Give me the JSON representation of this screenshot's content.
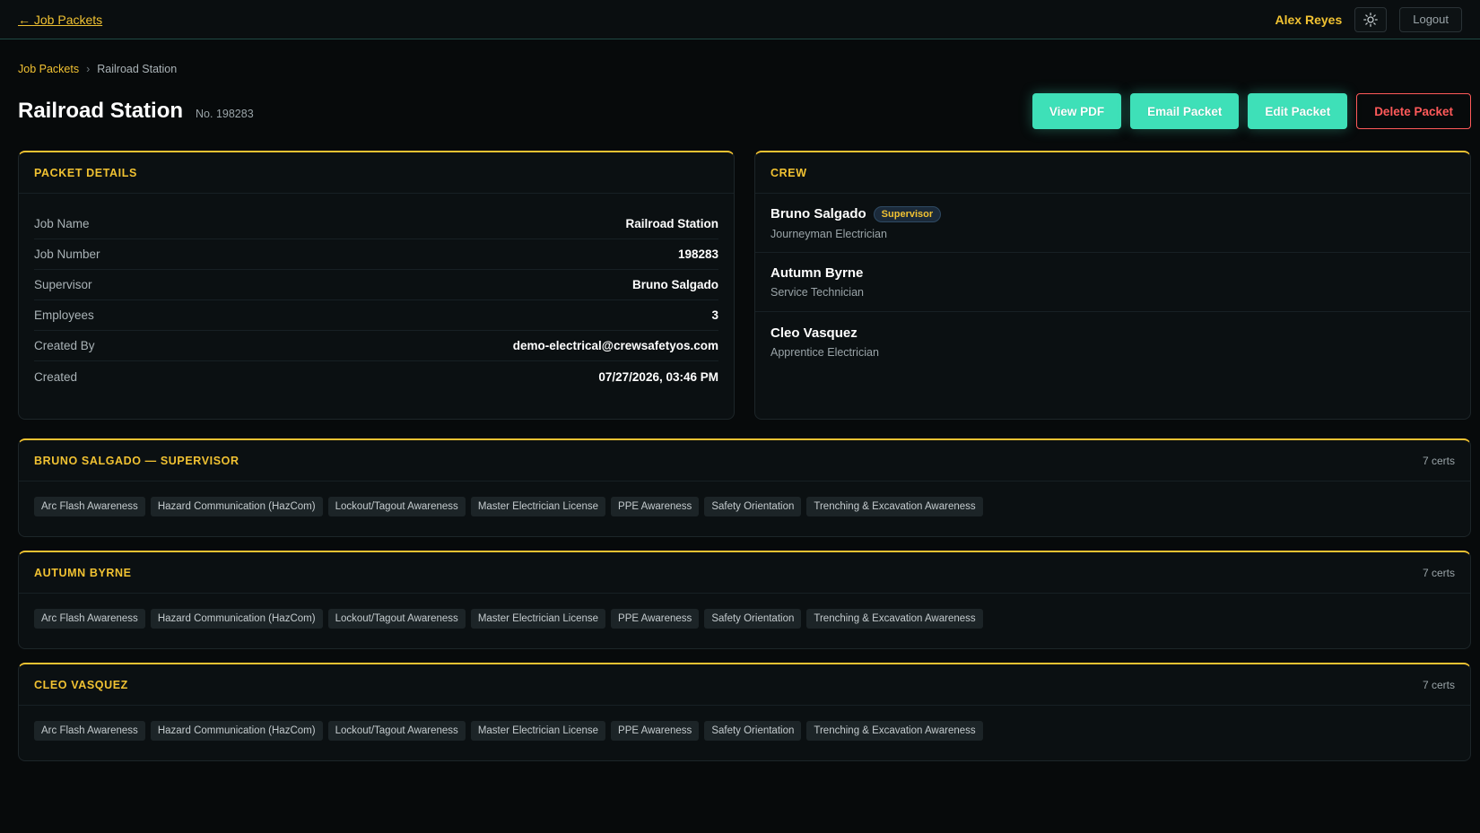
{
  "topbar": {
    "back_label": "← Job Packets",
    "user_name": "Alex Reyes",
    "logout_label": "Logout"
  },
  "breadcrumb": {
    "parent": "Job Packets",
    "separator": "›",
    "current": "Railroad Station"
  },
  "header": {
    "title": "Railroad Station",
    "job_no": "No. 198283",
    "actions": {
      "view_pdf": "View PDF",
      "email_packet": "Email Packet",
      "edit_packet": "Edit Packet",
      "delete_packet": "Delete Packet"
    }
  },
  "packet_details": {
    "title": "PACKET DETAILS",
    "rows": [
      {
        "label": "Job Name",
        "value": "Railroad Station"
      },
      {
        "label": "Job Number",
        "value": "198283"
      },
      {
        "label": "Supervisor",
        "value": "Bruno Salgado"
      },
      {
        "label": "Employees",
        "value": "3"
      },
      {
        "label": "Created By",
        "value": "demo-electrical@crewsafetyos.com"
      },
      {
        "label": "Created",
        "value": "07/27/2026, 03:46 PM"
      }
    ]
  },
  "crew": {
    "title": "CREW",
    "members": [
      {
        "name": "Bruno Salgado",
        "badge": "Supervisor",
        "role": "Journeyman Electrician"
      },
      {
        "name": "Autumn Byrne",
        "badge": "",
        "role": "Service Technician"
      },
      {
        "name": "Cleo Vasquez",
        "badge": "",
        "role": "Apprentice Electrician"
      }
    ]
  },
  "cert_sections": [
    {
      "title": "BRUNO SALGADO — SUPERVISOR",
      "count": "7 certs",
      "certs": [
        "Arc Flash Awareness",
        "Hazard Communication (HazCom)",
        "Lockout/Tagout Awareness",
        "Master Electrician License",
        "PPE Awareness",
        "Safety Orientation",
        "Trenching & Excavation Awareness"
      ]
    },
    {
      "title": "AUTUMN BYRNE",
      "count": "7 certs",
      "certs": [
        "Arc Flash Awareness",
        "Hazard Communication (HazCom)",
        "Lockout/Tagout Awareness",
        "Master Electrician License",
        "PPE Awareness",
        "Safety Orientation",
        "Trenching & Excavation Awareness"
      ]
    },
    {
      "title": "CLEO VASQUEZ",
      "count": "7 certs",
      "certs": [
        "Arc Flash Awareness",
        "Hazard Communication (HazCom)",
        "Lockout/Tagout Awareness",
        "Master Electrician License",
        "PPE Awareness",
        "Safety Orientation",
        "Trenching & Excavation Awareness"
      ]
    }
  ],
  "colors": {
    "accent": "#f1c232",
    "primary_button": "#3ee0b8",
    "danger": "#ff5a5a",
    "background": "#070a0b"
  },
  "icons": {
    "theme_toggle": "sun-icon"
  }
}
